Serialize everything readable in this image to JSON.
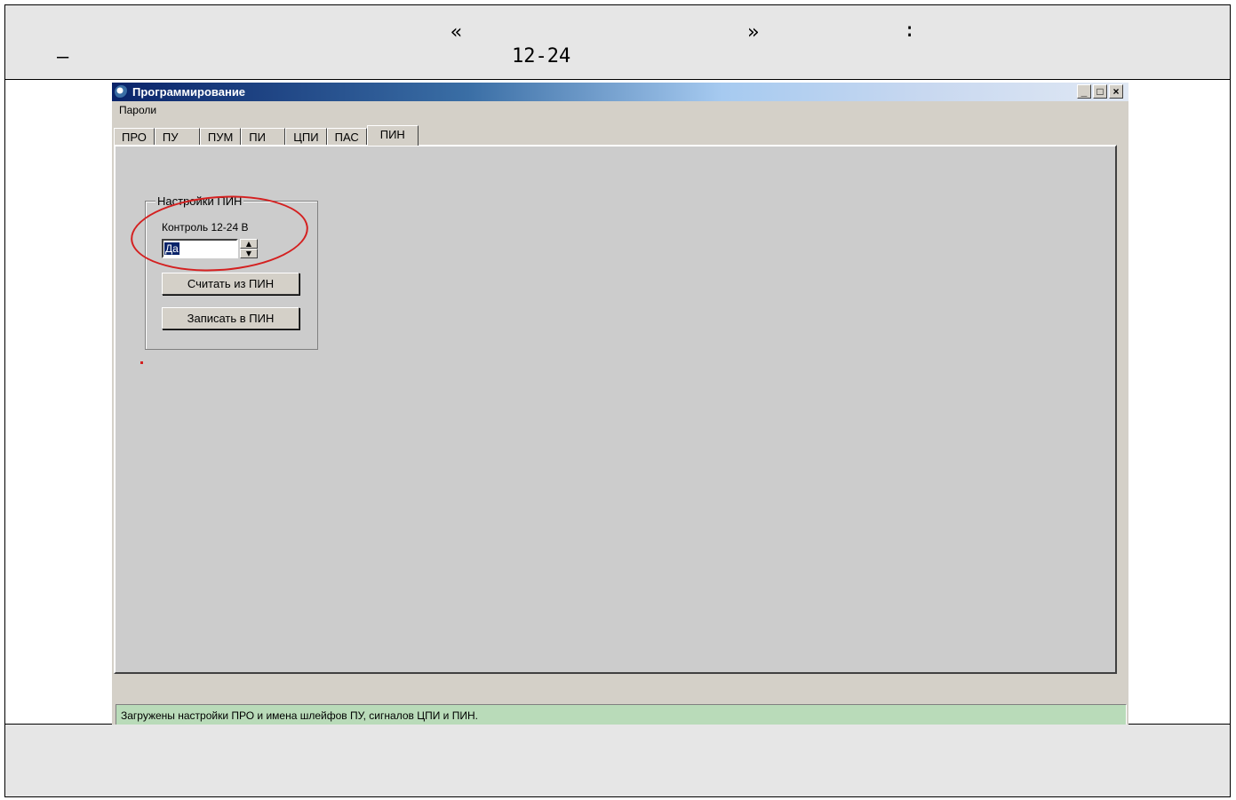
{
  "header": {
    "quote_open": "«",
    "quote_close": "»",
    "colon": ":",
    "dash": "–",
    "range": "12-24"
  },
  "window": {
    "title": "Программирование",
    "buttons": {
      "minimize": "_",
      "maximize": "□",
      "close": "×"
    },
    "menu": [
      "Пароли"
    ],
    "tabs": [
      "ПРО",
      "ПУ",
      "ПУМ",
      "ПИ",
      "ЦПИ",
      "ПАС",
      "ПИН"
    ],
    "active_tab": "ПИН",
    "group": {
      "legend": "Настройки ПИН",
      "field_label": "Контроль 12-24 В",
      "field_value": "Да",
      "read_button": "Считать из ПИН",
      "write_button": "Записать в ПИН"
    },
    "status": "Загружены настройки ПРО и имена шлейфов ПУ, сигналов ЦПИ и ПИН."
  },
  "colors": {
    "highlight": "#d42020",
    "status_bg": "#b9dbb9",
    "title_start": "#0a246a"
  }
}
